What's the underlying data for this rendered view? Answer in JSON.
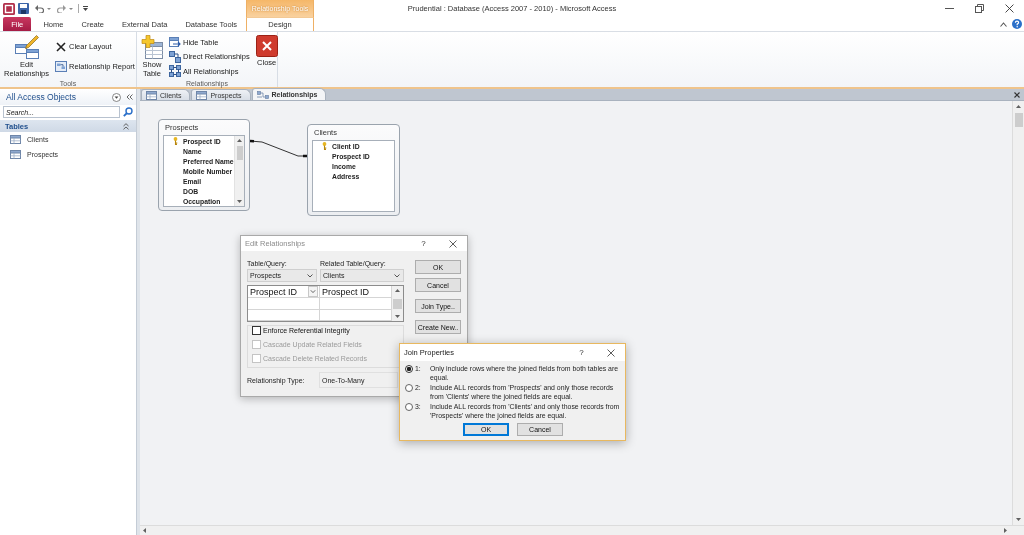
{
  "window": {
    "title": "Prudential : Database (Access 2007 - 2010) - Microsoft Access"
  },
  "contextual_tab_group": {
    "label": "Relationship Tools"
  },
  "ribbon_tabs": [
    {
      "label": "File",
      "kind": "backstage",
      "selected": false
    },
    {
      "label": "Home",
      "kind": "tab",
      "selected": false
    },
    {
      "label": "Create",
      "kind": "tab",
      "selected": false
    },
    {
      "label": "External Data",
      "kind": "tab",
      "selected": false
    },
    {
      "label": "Database Tools",
      "kind": "tab",
      "selected": false
    },
    {
      "label": "Design",
      "kind": "contextual",
      "selected": true
    }
  ],
  "ribbon_groups": [
    {
      "label": "Tools",
      "commands": [
        {
          "label": "Edit Relationships",
          "kind": "large"
        },
        {
          "label": "Clear Layout",
          "kind": "small"
        },
        {
          "label": "Relationship Report",
          "kind": "small"
        }
      ]
    },
    {
      "label": "Relationships",
      "commands": [
        {
          "label": "Show Table",
          "kind": "large"
        },
        {
          "label": "Hide Table",
          "kind": "small"
        },
        {
          "label": "Direct Relationships",
          "kind": "small"
        },
        {
          "label": "All Relationships",
          "kind": "small"
        },
        {
          "label": "Close",
          "kind": "large"
        }
      ]
    }
  ],
  "navigation_pane": {
    "title": "All Access Objects",
    "search": {
      "placeholder": "Search..."
    },
    "groups": [
      {
        "label": "Tables",
        "expanded": true,
        "items": [
          {
            "label": "Clients"
          },
          {
            "label": "Prospects"
          }
        ]
      }
    ]
  },
  "document_tabs": [
    {
      "label": "Clients",
      "kind": "table",
      "selected": false
    },
    {
      "label": "Prospects",
      "kind": "table",
      "selected": false
    },
    {
      "label": "Relationships",
      "kind": "relationships",
      "selected": true
    }
  ],
  "relationship_diagram": {
    "tables": [
      {
        "title": "Prospects",
        "fields": [
          {
            "name": "Prospect ID",
            "primary_key": true
          },
          {
            "name": "Name",
            "primary_key": false
          },
          {
            "name": "Preferred Name",
            "primary_key": false
          },
          {
            "name": "Mobile Number",
            "primary_key": false
          },
          {
            "name": "Email",
            "primary_key": false
          },
          {
            "name": "DOB",
            "primary_key": false
          },
          {
            "name": "Occupation",
            "primary_key": false
          }
        ]
      },
      {
        "title": "Clients",
        "fields": [
          {
            "name": "Client ID",
            "primary_key": true
          },
          {
            "name": "Prospect ID",
            "primary_key": false
          },
          {
            "name": "Income",
            "primary_key": false
          },
          {
            "name": "Address",
            "primary_key": false
          }
        ]
      }
    ]
  },
  "edit_relationships_dialog": {
    "title": "Edit Relationships",
    "active": false,
    "help_button": "?",
    "table_query": {
      "label": "Table/Query:",
      "value": "Prospects"
    },
    "related_table_query": {
      "label": "Related Table/Query:",
      "value": "Clients"
    },
    "field_pairs": [
      {
        "field": "Prospect ID",
        "related_field": "Prospect ID"
      }
    ],
    "options": [
      {
        "label": "Enforce Referential Integrity",
        "checked": false,
        "disabled": false
      },
      {
        "label": "Cascade Update Related Fields",
        "checked": false,
        "disabled": true
      },
      {
        "label": "Cascade Delete Related Records",
        "checked": false,
        "disabled": true
      }
    ],
    "relationship_type": {
      "label": "Relationship Type:",
      "value": "One-To-Many"
    },
    "buttons": [
      {
        "label": "OK"
      },
      {
        "label": "Cancel"
      },
      {
        "label": "Join Type.."
      },
      {
        "label": "Create New.."
      }
    ]
  },
  "join_properties_dialog": {
    "title": "Join Properties",
    "active": true,
    "help_button": "?",
    "options": [
      {
        "number": "1:",
        "text": "Only include rows where the joined fields from both tables are equal.",
        "selected": true
      },
      {
        "number": "2:",
        "text": "Include ALL records from 'Prospects' and only those records from 'Clients' where the joined fields are equal.",
        "selected": false
      },
      {
        "number": "3:",
        "text": "Include ALL records from 'Clients' and only those records from 'Prospects' where the joined fields are equal.",
        "selected": false
      }
    ],
    "buttons": [
      {
        "label": "OK",
        "default": true
      },
      {
        "label": "Cancel",
        "default": false
      }
    ]
  }
}
